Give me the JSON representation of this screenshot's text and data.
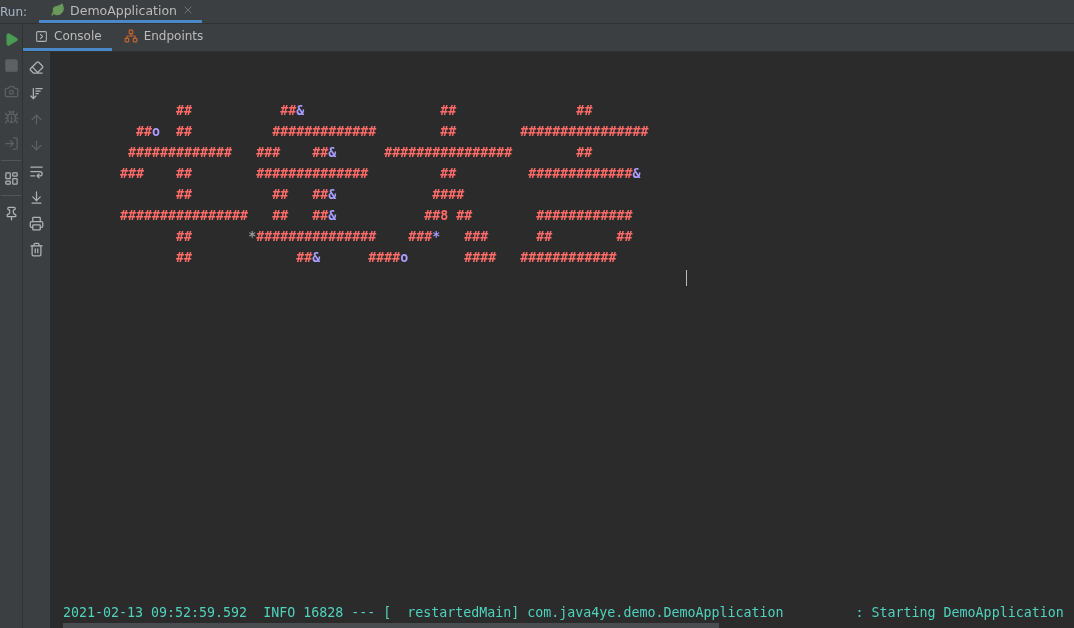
{
  "run_bar": {
    "label": "Run:",
    "tab": {
      "label": "DemoApplication",
      "selected": true,
      "closable": true
    }
  },
  "run_toolbar": [
    {
      "kind": "run",
      "disabled": false
    },
    {
      "kind": "stop",
      "disabled": true
    },
    {
      "kind": "camera",
      "disabled": true
    },
    {
      "kind": "bug",
      "disabled": true
    },
    {
      "kind": "exit",
      "disabled": true
    },
    {
      "kind": "separator"
    },
    {
      "kind": "layout",
      "disabled": false
    },
    {
      "kind": "separator"
    },
    {
      "kind": "pin",
      "disabled": false
    }
  ],
  "tabs": [
    {
      "label": "Console",
      "kind": "console",
      "selected": true
    },
    {
      "label": "Endpoints",
      "kind": "endpoints",
      "selected": false
    }
  ],
  "console_toolbar": [
    {
      "kind": "clear",
      "disabled": false
    },
    {
      "kind": "sort",
      "disabled": false
    },
    {
      "kind": "up",
      "disabled": true
    },
    {
      "kind": "down",
      "disabled": true
    },
    {
      "kind": "wrap",
      "disabled": false
    },
    {
      "kind": "scroll_end",
      "disabled": false
    },
    {
      "kind": "print",
      "disabled": false
    },
    {
      "kind": "trash",
      "disabled": false
    }
  ],
  "console": {
    "banner": [
      [
        {
          "text": "              ##           ##",
          "color": "#ff6b68"
        },
        {
          "text": "&",
          "color": "#a99cff"
        },
        {
          "text": "                 ##               ##",
          "color": "#ff6b68"
        }
      ],
      [
        {
          "text": "         ##",
          "color": "#ff6b68"
        },
        {
          "text": "o",
          "color": "#a99cff"
        },
        {
          "text": "  ##          #############        ##        ################",
          "color": "#ff6b68"
        }
      ],
      [
        {
          "text": "        #############   ###    ##",
          "color": "#ff6b68"
        },
        {
          "text": "&",
          "color": "#a99cff"
        },
        {
          "text": "      ################        ##",
          "color": "#ff6b68"
        }
      ],
      [
        {
          "text": "       ###    ##        ##############         ##         #############",
          "color": "#ff6b68"
        },
        {
          "text": "&",
          "color": "#a99cff"
        }
      ],
      [
        {
          "text": "              ##          ##   ##",
          "color": "#ff6b68"
        },
        {
          "text": "&",
          "color": "#a99cff"
        },
        {
          "text": "            ####",
          "color": "#ff6b68"
        }
      ],
      [
        {
          "text": "       ################   ##   ##",
          "color": "#ff6b68"
        },
        {
          "text": "&",
          "color": "#a99cff"
        },
        {
          "text": "           ##8 ##        ############",
          "color": "#ff6b68"
        }
      ],
      [
        {
          "text": "              ##       ",
          "color": "#ff6b68"
        },
        {
          "text": "*",
          "color": "#9a9a9a"
        },
        {
          "text": "###############    ###",
          "color": "#ff6b68"
        },
        {
          "text": "*",
          "color": "#a99cff"
        },
        {
          "text": "   ###      ##        ##",
          "color": "#ff6b68"
        }
      ],
      [
        {
          "text": "              ##             ##",
          "color": "#ff6b68"
        },
        {
          "text": "&",
          "color": "#a99cff"
        },
        {
          "text": "      ####",
          "color": "#ff6b68"
        },
        {
          "text": "o",
          "color": "#a99cff"
        },
        {
          "text": "       ####   ############",
          "color": "#ff6b68"
        }
      ]
    ],
    "log_line": "2021-02-13 09:52:59.592  INFO 16828 --- [  restartedMain] com.java4ye.demo.DemoApplication         : Starting DemoApplication"
  }
}
